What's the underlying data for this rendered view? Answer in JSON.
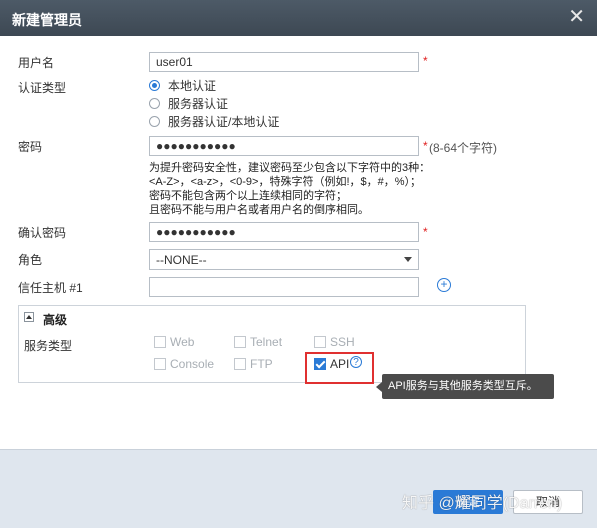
{
  "dialog": {
    "title": "新建管理员",
    "close_icon": "close-icon"
  },
  "form": {
    "username": {
      "label": "用户名",
      "value": "user01",
      "required_mark": "*"
    },
    "auth_type": {
      "label": "认证类型",
      "options": [
        "本地认证",
        "服务器认证",
        "服务器认证/本地认证"
      ],
      "selected": "本地认证"
    },
    "password": {
      "label": "密码",
      "value": "●●●●●●●●●●●",
      "required_mark": "*",
      "hint": "(8-64个字符)"
    },
    "password_tip": [
      "为提升密码安全性，建议密码至少包含以下字符中的3种：",
      "<A-Z>，<a-z>，<0-9>，特殊字符（例如!，$，#，%）；",
      "密码不能包含两个以上连续相同的字符；",
      "且密码不能与用户名或者用户名的倒序相同。"
    ],
    "confirm_password": {
      "label": "确认密码",
      "value": "●●●●●●●●●●●",
      "required_mark": "*"
    },
    "role": {
      "label": "角色",
      "value": "--NONE--"
    },
    "trusted_host": {
      "label": "信任主机 #1",
      "value": "",
      "add_icon": "plus-circle-icon"
    }
  },
  "advanced": {
    "title": "高级",
    "service_type_label": "服务类型",
    "services": [
      {
        "label": "Web",
        "checked": false,
        "enabled": false
      },
      {
        "label": "Telnet",
        "checked": false,
        "enabled": false
      },
      {
        "label": "SSH",
        "checked": false,
        "enabled": false
      },
      {
        "label": "Console",
        "checked": false,
        "enabled": false
      },
      {
        "label": "FTP",
        "checked": false,
        "enabled": false
      },
      {
        "label": "API",
        "checked": true,
        "enabled": true
      }
    ],
    "help_icon": "question-circle-icon",
    "tooltip": "API服务与其他服务类型互斥。"
  },
  "footer": {
    "ok_label": "确定",
    "cancel_label": "取消",
    "watermark": "知乎 @耀同学(Darren)"
  },
  "colors": {
    "titlebar": "#3d4853",
    "accent": "#2a7ad6",
    "required": "#e02020",
    "highlight_frame": "#e03030",
    "tooltip_bg": "#4b4b4b"
  }
}
